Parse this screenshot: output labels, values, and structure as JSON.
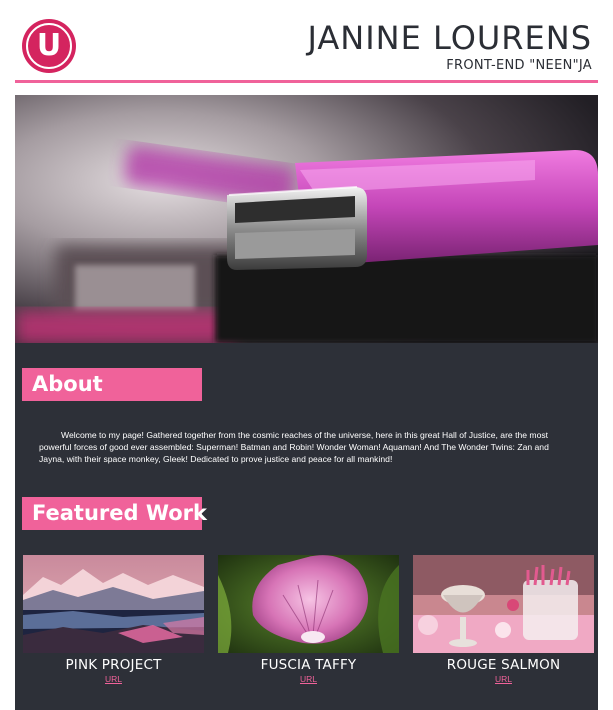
{
  "header": {
    "logo_letter": "U",
    "title": "JANINE LOURENS",
    "subtitle": "FRONT-END \"NEEN\"JA"
  },
  "colors": {
    "accent": "#f0629a",
    "logo": "#d4245f",
    "panel": "#2d3038",
    "text_dark": "#2b2e35"
  },
  "hero": {
    "icon": "usb-drive-photo"
  },
  "about": {
    "heading": "About",
    "body": "Welcome to my page! Gathered together from the cosmic reaches of the universe, here in this great Hall of Justice, are the most powerful forces of good ever assembled: Superman! Batman and Robin! Wonder Woman! Aquaman! And The Wonder Twins: Zan and Jayna, with their space monkey, Gleek! Dedicated to prove justice and peace for all mankind!"
  },
  "featured": {
    "heading": "Featured Work",
    "items": [
      {
        "title": "PINK PROJECT",
        "link": "URL",
        "image": "pink-mountains-photo"
      },
      {
        "title": "FUSCIA TAFFY",
        "link": "URL",
        "image": "pink-flower-photo"
      },
      {
        "title": "ROUGE SALMON",
        "link": "URL",
        "image": "candy-table-photo"
      }
    ]
  }
}
